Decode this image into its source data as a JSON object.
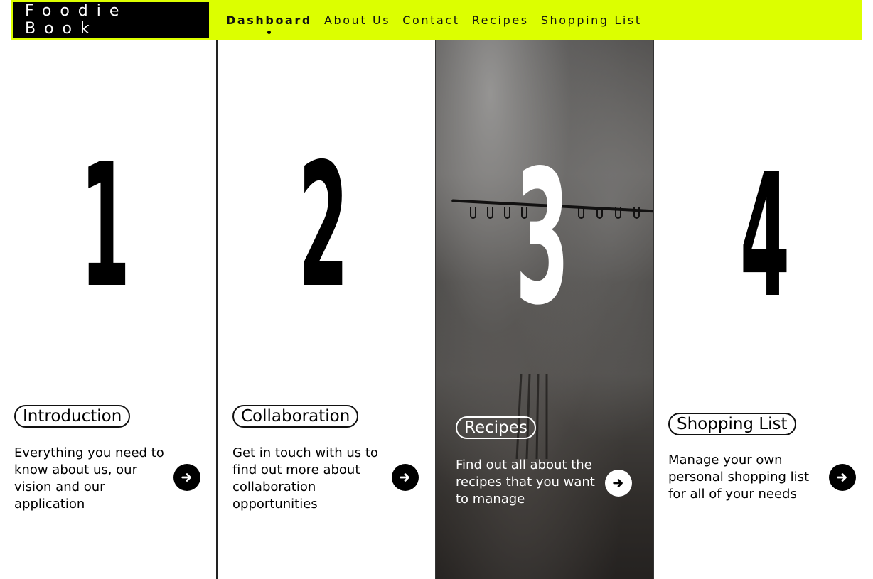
{
  "nav": {
    "brand": "Foodie Book",
    "links": [
      {
        "label": "Dashboard",
        "active": true
      },
      {
        "label": "About Us",
        "active": false
      },
      {
        "label": "Contact",
        "active": false
      },
      {
        "label": "Recipes",
        "active": false
      },
      {
        "label": "Shopping List",
        "active": false
      }
    ]
  },
  "columns": [
    {
      "number": "1",
      "title": "Introduction",
      "description": "Everything you need to know about us, our vision and our application",
      "icon": "arrow-right-icon"
    },
    {
      "number": "2",
      "title": "Collaboration",
      "description": "Get in touch with us to find out more about collaboration opportunities",
      "icon": "arrow-right-icon"
    },
    {
      "number": "3",
      "title": "Recipes",
      "description": "Find out all about the recipes that you want to manage",
      "icon": "arrow-right-icon",
      "highlighted": true
    },
    {
      "number": "4",
      "title": "Shopping List",
      "description": "Manage your own personal shopping list for all of your needs",
      "icon": "arrow-right-icon"
    }
  ],
  "colors": {
    "accent": "#dcff00",
    "brand_bg": "#000000",
    "text": "#000000",
    "highlight_text": "#ffffff"
  }
}
